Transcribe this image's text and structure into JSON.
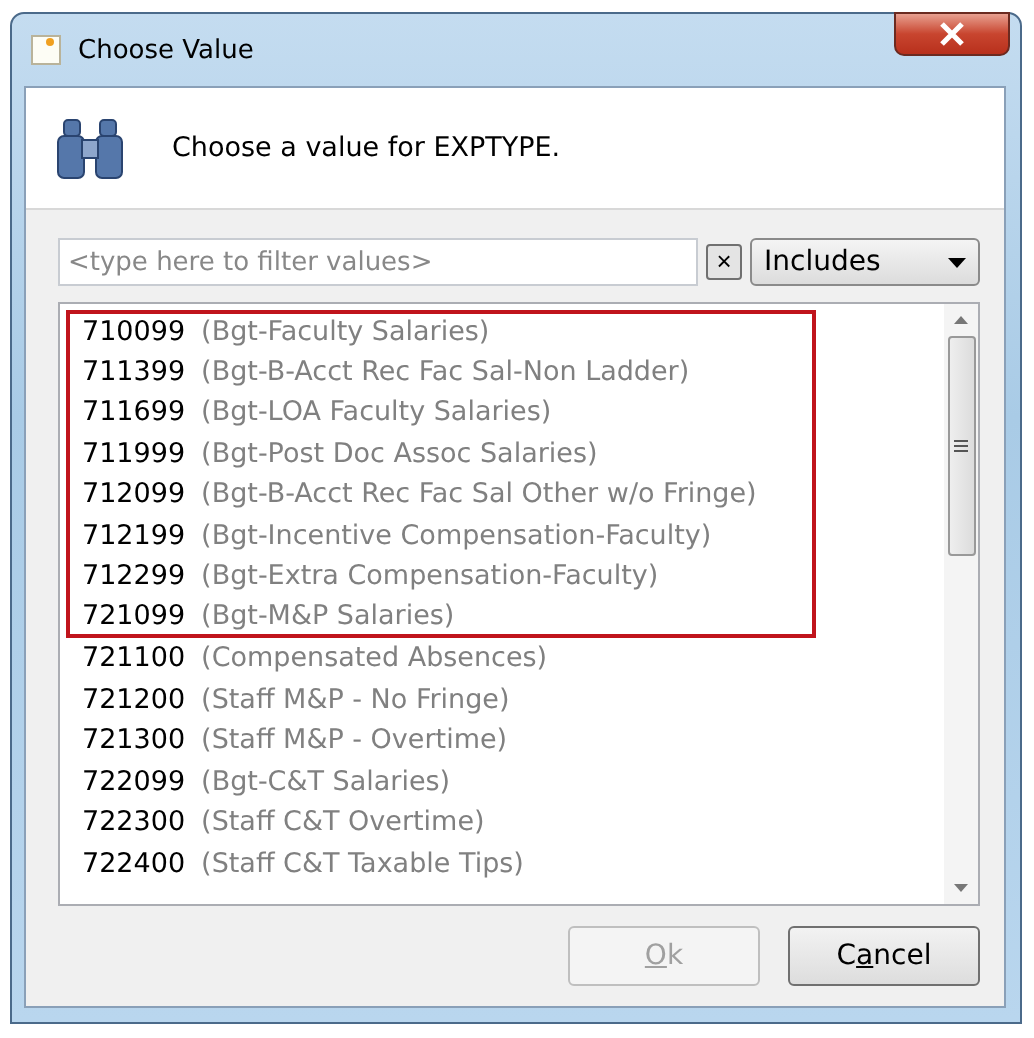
{
  "window": {
    "title": "Choose Value"
  },
  "header": {
    "prompt": "Choose a value for EXPTYPE."
  },
  "filter": {
    "placeholder": "<type here to filter values>",
    "clear_label": "×",
    "mode": "Includes"
  },
  "items": [
    {
      "code": "710099",
      "description": "(Bgt-Faculty Salaries)",
      "highlighted": true
    },
    {
      "code": "711399",
      "description": "(Bgt-B-Acct Rec Fac Sal-Non Ladder)",
      "highlighted": true
    },
    {
      "code": "711699",
      "description": "(Bgt-LOA Faculty Salaries)",
      "highlighted": true
    },
    {
      "code": "711999",
      "description": "(Bgt-Post Doc Assoc Salaries)",
      "highlighted": true
    },
    {
      "code": "712099",
      "description": "(Bgt-B-Acct Rec Fac Sal Other w/o Fringe)",
      "highlighted": true
    },
    {
      "code": "712199",
      "description": "(Bgt-Incentive Compensation-Faculty)",
      "highlighted": true
    },
    {
      "code": "712299",
      "description": "(Bgt-Extra Compensation-Faculty)",
      "highlighted": true
    },
    {
      "code": "721099",
      "description": "(Bgt-M&P Salaries)",
      "highlighted": true
    },
    {
      "code": "721100",
      "description": "(Compensated Absences)",
      "highlighted": false
    },
    {
      "code": "721200",
      "description": "(Staff M&P - No Fringe)",
      "highlighted": false
    },
    {
      "code": "721300",
      "description": "(Staff M&P - Overtime)",
      "highlighted": false
    },
    {
      "code": "722099",
      "description": "(Bgt-C&T Salaries)",
      "highlighted": false
    },
    {
      "code": "722300",
      "description": "(Staff C&T Overtime)",
      "highlighted": false
    },
    {
      "code": "722400",
      "description": "(Staff C&T Taxable Tips)",
      "highlighted": false
    }
  ],
  "buttons": [
    {
      "mnemonic": "O",
      "after": "k",
      "disabled": true
    },
    {
      "before": "C",
      "mnemonic": "a",
      "after": "ncel",
      "disabled": false
    }
  ]
}
